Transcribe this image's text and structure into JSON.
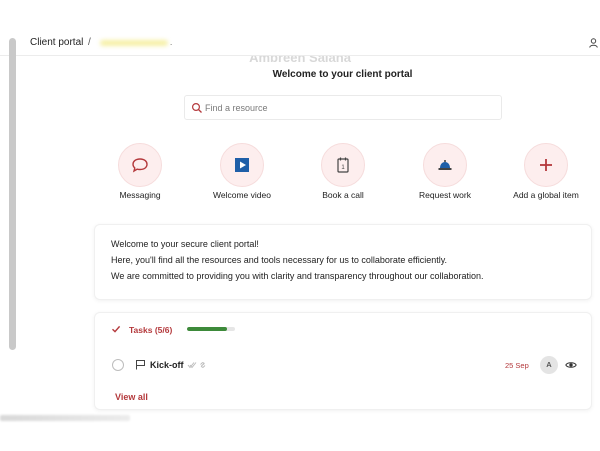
{
  "header": {
    "breadcrumb_root": "Client portal",
    "separator": "/",
    "trailing": "."
  },
  "portal": {
    "banner_partial": "Ambreen Saiana",
    "welcome_title": "Welcome to your client portal"
  },
  "search": {
    "placeholder": "Find a resource",
    "value": ""
  },
  "quick_actions": [
    {
      "label": "Messaging",
      "icon": "chat-bubble-icon"
    },
    {
      "label": "Welcome video",
      "icon": "video-play-icon"
    },
    {
      "label": "Book a call",
      "icon": "calendar-icon"
    },
    {
      "label": "Request work",
      "icon": "service-bell-icon"
    },
    {
      "label": "Add a global item",
      "icon": "plus-icon"
    }
  ],
  "intro": {
    "line1": "Welcome to your secure client portal!",
    "line2": "Here, you'll find all the resources and tools necessary for us to collaborate efficiently.",
    "line3": "We are committed to providing you with clarity and transparency throughout our collaboration."
  },
  "tasks": {
    "label": "Tasks (5/6)",
    "progress_fraction": 0.83,
    "items": [
      {
        "name": "Kick-off",
        "date": "25 Sep",
        "assignee_initial": "A"
      }
    ],
    "view_all": "View all"
  },
  "colors": {
    "accent": "#b4393c",
    "tile_bg": "#fdeeee",
    "progress": "#3d8a3a",
    "video_icon": "#1f5fa8"
  }
}
